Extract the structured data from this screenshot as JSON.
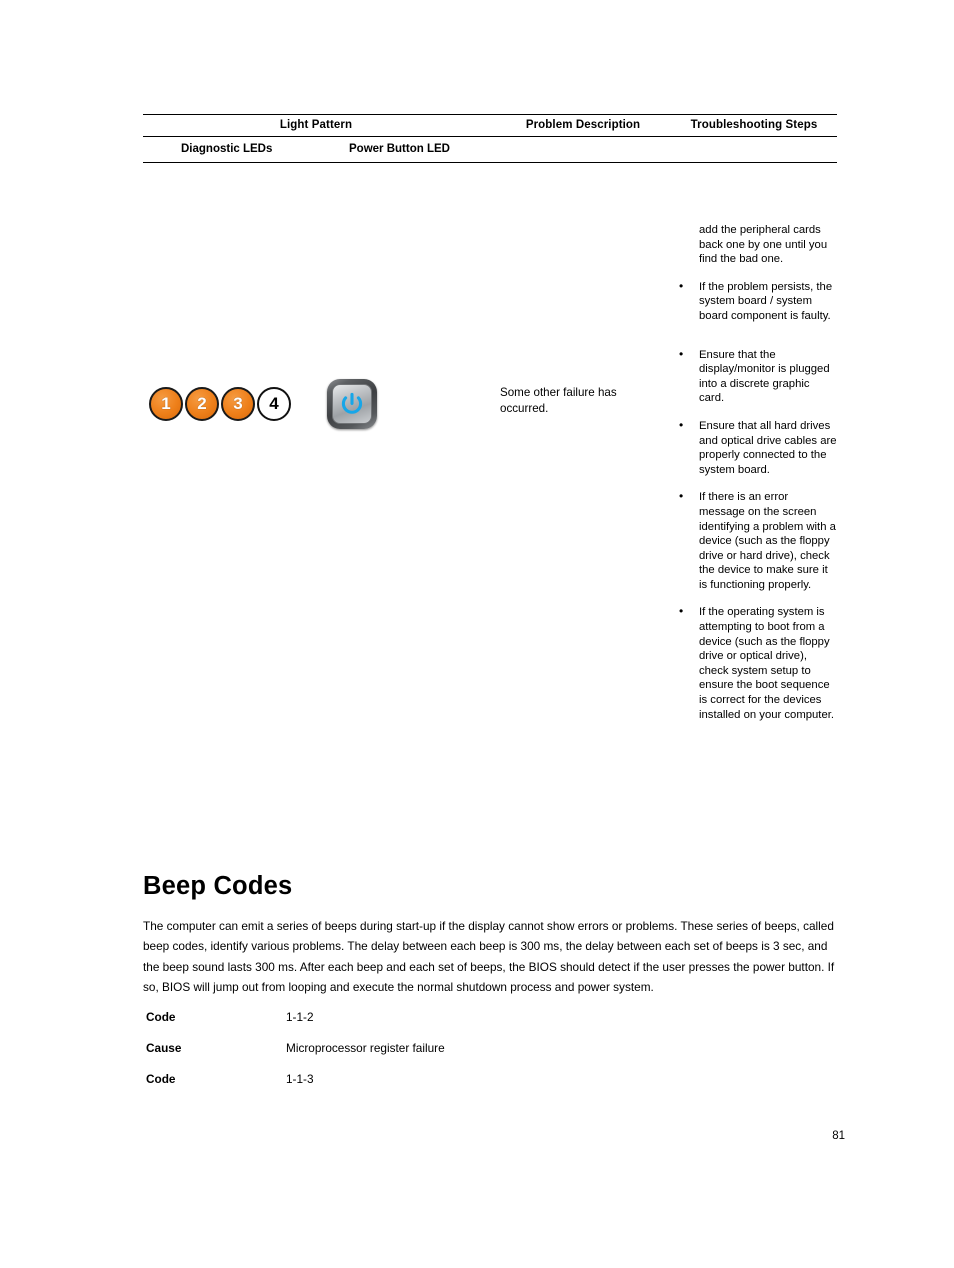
{
  "document": {
    "page_number": "81"
  },
  "table": {
    "headers": {
      "light_pattern": "Light Pattern",
      "problem_description": "Problem Description",
      "troubleshooting_steps": "Troubleshooting Steps"
    },
    "subheaders": {
      "diagnostic_leds": "Diagnostic LEDs",
      "power_button_led": "Power Button LED"
    },
    "row": {
      "leds": [
        {
          "number": "1",
          "state": "on"
        },
        {
          "number": "2",
          "state": "on"
        },
        {
          "number": "3",
          "state": "on"
        },
        {
          "number": "4",
          "state": "off"
        }
      ],
      "power_button_state": "on",
      "power_button_color": "#17a6e8",
      "problem_description": "Some other failure has occurred.",
      "steps_continuation": "add the peripheral cards back one by one until you find the bad one.",
      "steps": [
        "If the problem persists, the system board / system board component is faulty.",
        "Ensure that the display/monitor is plugged into a discrete graphic card.",
        "Ensure that all hard drives and optical drive cables are properly connected to the system board.",
        "If there is an error message on the screen identifying a problem with a device (such as the floppy drive or hard drive), check the device to make sure it is functioning properly.",
        "If the operating system is attempting to boot from a device (such as the floppy drive or optical drive), check system setup to ensure the boot sequence is correct for the devices installed on your computer."
      ],
      "bullet_glyph": "•"
    }
  },
  "beep_codes": {
    "heading": "Beep Codes",
    "paragraph": "The computer can emit a series of beeps during start-up if the display cannot show errors or problems. These series of beeps, called beep codes, identify various problems. The delay between each beep is 300 ms, the delay between each set of beeps is 3 sec, and the beep sound lasts 300 ms. After each beep and each set of beeps, the BIOS should detect if the user presses the power button. If so, BIOS will jump out from looping and execute the normal shutdown process and power system.",
    "rows": [
      {
        "term": "Code",
        "value": "1-1-2"
      },
      {
        "term": "Cause",
        "value": "Microprocessor register failure"
      },
      {
        "term": "Code",
        "value": "1-1-3"
      }
    ]
  },
  "colors": {
    "led_on": "#ee7f19",
    "led_off": "#ffffff",
    "power_glyph": "#17a6e8",
    "text": "#000000"
  }
}
